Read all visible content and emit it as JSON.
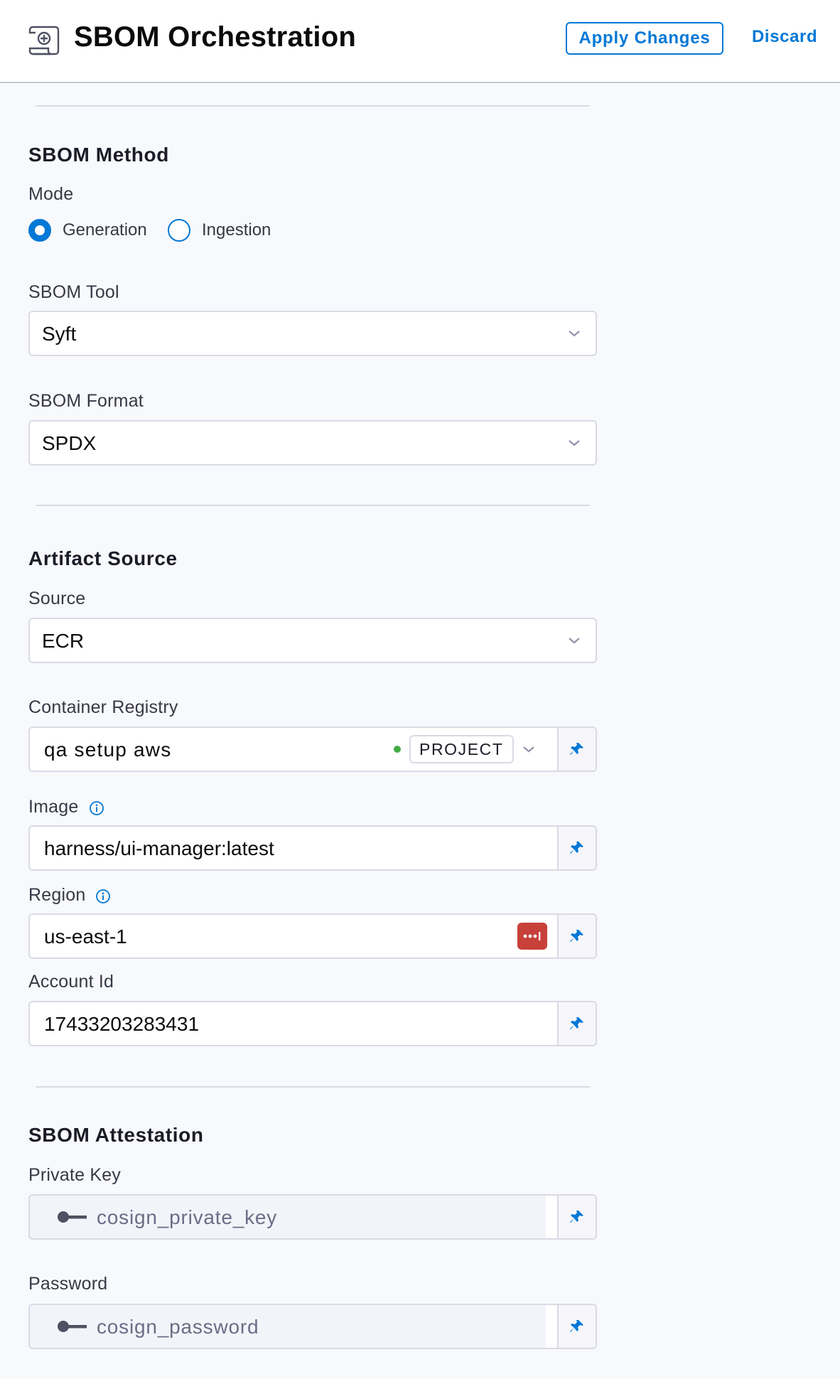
{
  "header": {
    "icon": "sbom-document-icon",
    "title": "SBOM Orchestration",
    "apply_label": "Apply Changes",
    "discard_label": "Discard",
    "accent_color": "#0278d5"
  },
  "sbom_method": {
    "section_title": "SBOM Method",
    "mode_label": "Mode",
    "mode_options": [
      {
        "label": "Generation",
        "selected": true
      },
      {
        "label": "Ingestion",
        "selected": false
      }
    ],
    "tool_label": "SBOM Tool",
    "tool_value": "Syft",
    "format_label": "SBOM Format",
    "format_value": "SPDX"
  },
  "artifact_source": {
    "section_title": "Artifact Source",
    "source_label": "Source",
    "source_value": "ECR",
    "registry_label": "Container Registry",
    "registry_value": "qa setup aws",
    "registry_scope": "PROJECT",
    "registry_status_color": "#42ab45",
    "image_label": "Image",
    "image_value": "harness/ui-manager:latest",
    "region_label": "Region",
    "region_value": "us-east-1",
    "account_label": "Account Id",
    "account_value": "17433203283431"
  },
  "sbom_attestation": {
    "section_title": "SBOM Attestation",
    "private_key_label": "Private Key",
    "private_key_value": "cosign_private_key",
    "password_label": "Password",
    "password_value": "cosign_password"
  }
}
